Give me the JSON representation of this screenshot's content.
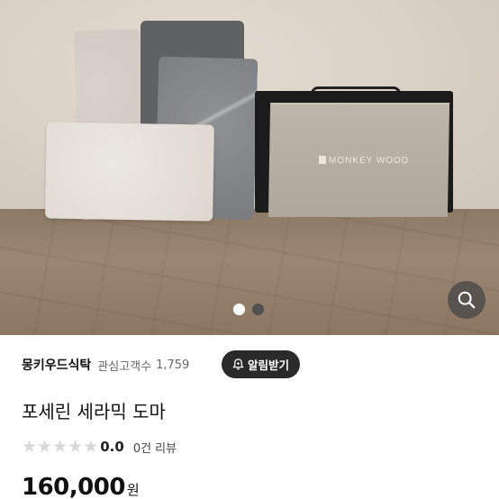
{
  "photo": {
    "box_logo_text": "MONKEY WOOD",
    "carousel": {
      "total": 2,
      "active_index": 0
    },
    "zoom_icon": "search-icon"
  },
  "store": {
    "name": "몽키우드식탁",
    "followers_label": "관심고객수",
    "followers_count": "1,759",
    "notify_label": "알림받기",
    "notify_icon": "bell-plus-icon"
  },
  "product": {
    "title": "포세린 세라믹 도마",
    "rating": "0.0",
    "stars_filled": 0,
    "stars_total": 5,
    "review_label": "0건 리뷰",
    "price": "160,000",
    "currency": "원"
  },
  "colors": {
    "notify_bg": "#2a2a2a",
    "star_empty": "#d8d8d8",
    "dot_active": "#ffffff",
    "dot_inactive": "#505050"
  }
}
